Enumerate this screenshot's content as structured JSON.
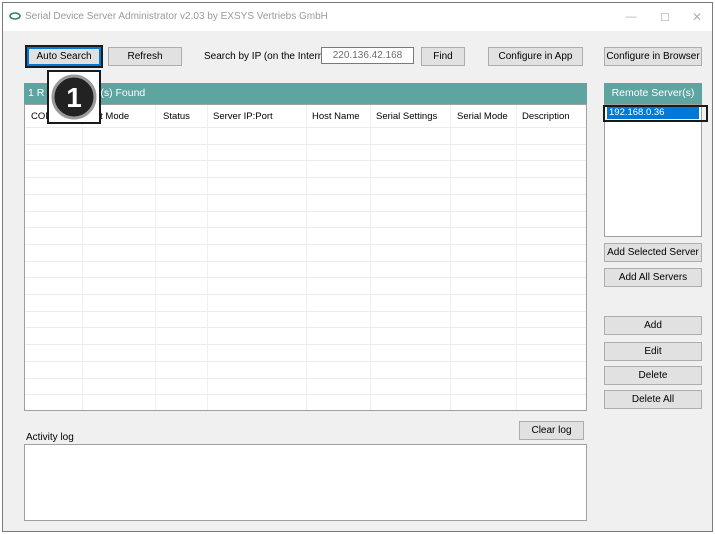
{
  "window": {
    "title": "Serial Device Server Administrator v2.03 by EXSYS Vertriebs GmbH",
    "minimize_glyph": "—",
    "maximize_glyph": "☐",
    "close_glyph": "✕"
  },
  "toolbar": {
    "auto_search": "Auto Search",
    "refresh": "Refresh",
    "search_ip_label": "Search by IP (on the Internet):",
    "ip_value": "220.136.42.168",
    "find": "Find",
    "configure_app": "Configure in App",
    "configure_browser": "Configure in Browser"
  },
  "servers_panel": {
    "header_prefix": "1 R",
    "header_suffix": "(s) Found",
    "columns": [
      "COM",
      "Net Mode",
      "Status",
      "Server IP:Port",
      "Host Name",
      "Serial Settings",
      "Serial Mode",
      "Description"
    ]
  },
  "remote_panel": {
    "header": "Remote Server(s)",
    "items": [
      "192.168.0.36"
    ],
    "add_selected": "Add Selected Server",
    "add_all": "Add All Servers",
    "add": "Add",
    "edit": "Edit",
    "delete": "Delete",
    "delete_all": "Delete All"
  },
  "log": {
    "label": "Activity log",
    "clear": "Clear log"
  },
  "annotation": {
    "step_number": "1"
  }
}
